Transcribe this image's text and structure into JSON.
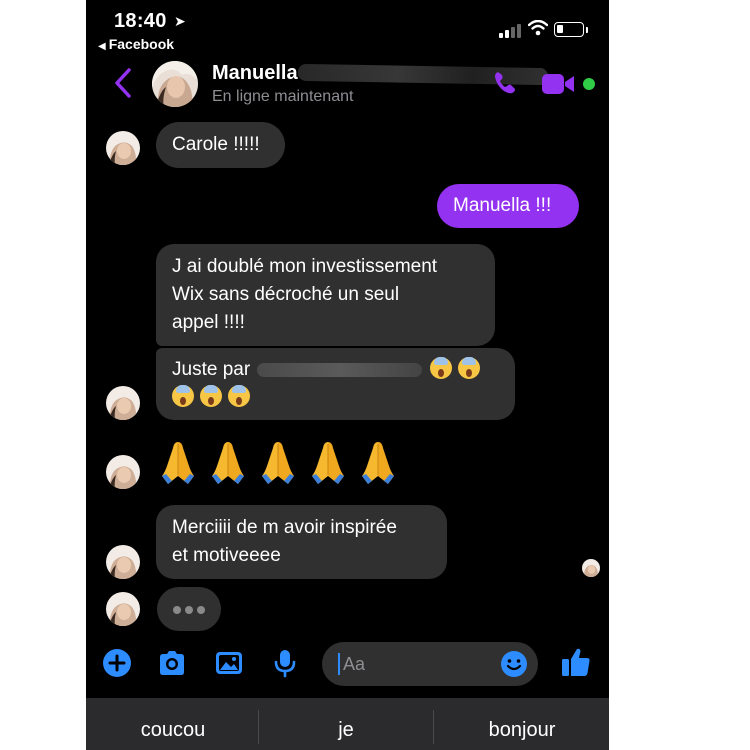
{
  "status_bar": {
    "time": "18:40",
    "location_icon": "location-arrow-icon",
    "back_app": "Facebook",
    "signal": "signal-bars-icon",
    "wifi": "wifi-icon",
    "battery": "battery-icon",
    "battery_level": 0.25
  },
  "header": {
    "contact_name": "Manuella",
    "presence": "En ligne maintenant",
    "accent_color": "#9332f0",
    "online_color": "#31cc46"
  },
  "messages": [
    {
      "direction": "received",
      "text": "Carole !!!!!"
    },
    {
      "direction": "sent",
      "text": "Manuella !!!"
    },
    {
      "direction": "received",
      "lines": [
        "J ai doublé mon investissement",
        "Wix sans décroché un seul",
        "appel !!!!"
      ]
    },
    {
      "direction": "received",
      "prefix": "Juste par"
    },
    {
      "direction": "received",
      "emoji": "🙏🙏🙏🙏🙏",
      "emoji_name": "folded-hands"
    },
    {
      "direction": "received",
      "lines": [
        "Merciiii de m avoir inspirée",
        "et motiveeee"
      ]
    }
  ],
  "composer": {
    "placeholder": "Aa",
    "tools": [
      "plus-icon",
      "camera-icon",
      "gallery-icon",
      "microphone-icon"
    ],
    "emoji_button": "smiley-icon",
    "like_button": "thumbs-up-icon"
  },
  "suggestions": [
    "coucou",
    "je",
    "bonjour"
  ],
  "colors": {
    "background": "#000000",
    "received_bubble": "#303030",
    "sent_bubble": "#9332f0",
    "tool_blue": "#2d8cff",
    "keyboard_bar": "#2b2b2d"
  }
}
